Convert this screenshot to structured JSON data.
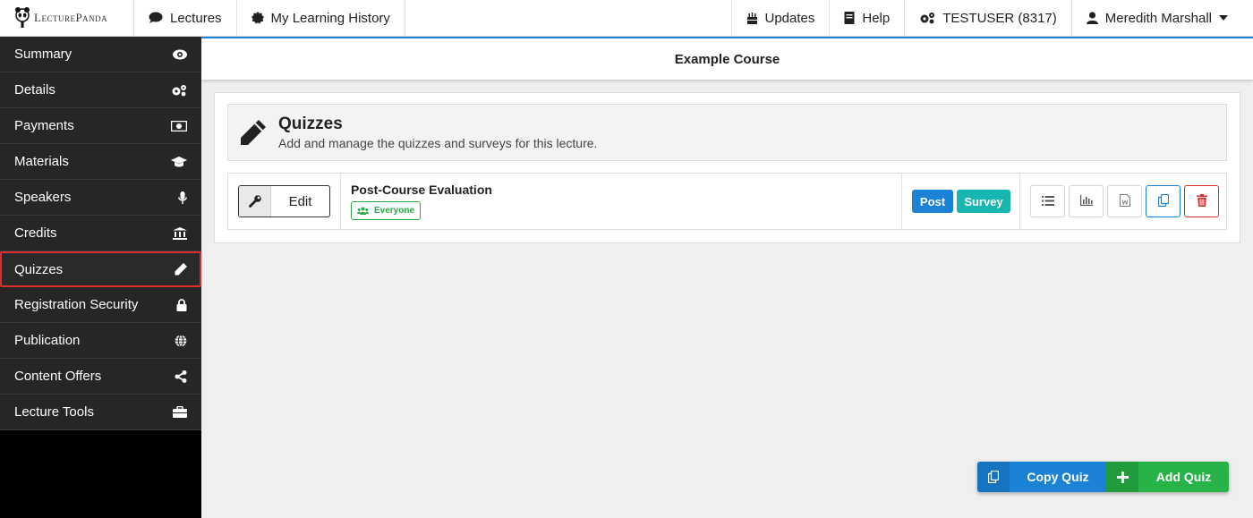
{
  "brand": {
    "name": "LecturePanda"
  },
  "topnav": {
    "left": [
      {
        "label": "Lectures",
        "icon": "comment-icon"
      },
      {
        "label": "My Learning History",
        "icon": "badge-icon"
      }
    ],
    "right": [
      {
        "label": "Updates",
        "icon": "cake-icon"
      },
      {
        "label": "Help",
        "icon": "book-icon"
      },
      {
        "label": "TESTUSER (8317)",
        "icon": "cogs-icon"
      },
      {
        "label": "Meredith Marshall",
        "icon": "user-icon"
      }
    ]
  },
  "sidebar": {
    "items": [
      {
        "label": "Summary",
        "icon": "eye-icon"
      },
      {
        "label": "Details",
        "icon": "cogs-icon"
      },
      {
        "label": "Payments",
        "icon": "money-icon"
      },
      {
        "label": "Materials",
        "icon": "graduation-cap-icon"
      },
      {
        "label": "Speakers",
        "icon": "microphone-icon"
      },
      {
        "label": "Credits",
        "icon": "institution-icon"
      },
      {
        "label": "Quizzes",
        "icon": "pencil-icon",
        "active": true
      },
      {
        "label": "Registration Security",
        "icon": "lock-icon"
      },
      {
        "label": "Publication",
        "icon": "globe-icon"
      },
      {
        "label": "Content Offers",
        "icon": "share-icon"
      },
      {
        "label": "Lecture Tools",
        "icon": "briefcase-icon"
      }
    ]
  },
  "course": {
    "title": "Example Course"
  },
  "quizzes": {
    "title": "Quizzes",
    "description": "Add and manage the quizzes and surveys for this lecture.",
    "items": [
      {
        "edit_label": "Edit",
        "title": "Post-Course Evaluation",
        "audience": "Everyone",
        "tags": [
          "Post",
          "Survey"
        ]
      }
    ]
  },
  "actions": {
    "copy_quiz": "Copy Quiz",
    "add_quiz": "Add Quiz"
  },
  "colors": {
    "primary": "#1b82d6",
    "success": "#27b347",
    "danger": "#d9302f",
    "teal": "#17b6b0",
    "sidebar_bg": "#262626"
  }
}
